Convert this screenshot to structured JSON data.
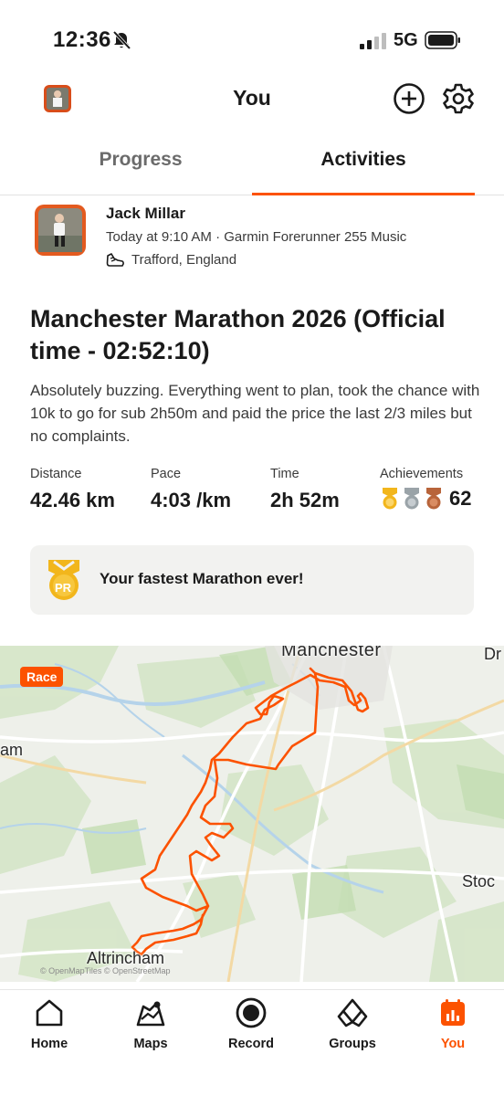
{
  "status_bar": {
    "time": "12:36",
    "network": "5G"
  },
  "header": {
    "title": "You",
    "icons": [
      "profile-avatar",
      "add-circle-icon",
      "gear-icon"
    ]
  },
  "tabs": [
    {
      "label": "Progress",
      "active": false
    },
    {
      "label": "Activities",
      "active": true
    }
  ],
  "activity": {
    "athlete_name": "Jack Millar",
    "meta": "Today at 9:10 AM · Garmin Forerunner 255 Music",
    "location": "Trafford, England",
    "title": "Manchester Marathon 2026 (Official time - 02:52:10)",
    "description": "Absolutely buzzing. Everything went to plan, took the chance with 10k to go for sub 2h50m and paid the price the last 2/3 miles but no complaints.",
    "stats": {
      "distance_label": "Distance",
      "distance_value": "42.46 km",
      "pace_label": "Pace",
      "pace_value": "4:03 /km",
      "time_label": "Time",
      "time_value": "2h 52m",
      "achievements_label": "Achievements",
      "achievements_value": "62"
    },
    "pr_card": {
      "badge": "PR",
      "text": "Your fastest Marathon ever!"
    }
  },
  "map": {
    "race_badge": "Race",
    "labels": {
      "manchester": "Manchester",
      "altrincham": "Altrincham",
      "west_edge": "am",
      "east_top": "Dr",
      "east_mid": "Stoc"
    },
    "attribution": "© OpenMapTiles © OpenStreetMap",
    "route_color": "#fc5200"
  },
  "bottom_nav": [
    {
      "label": "Home",
      "icon": "home-icon"
    },
    {
      "label": "Maps",
      "icon": "map-icon"
    },
    {
      "label": "Record",
      "icon": "record-icon"
    },
    {
      "label": "Groups",
      "icon": "groups-icon"
    },
    {
      "label": "You",
      "icon": "you-icon",
      "active": true
    }
  ],
  "colors": {
    "accent": "#fc5200",
    "gold": "#f2b61c",
    "silver": "#9aa3a8",
    "bronze": "#b8643a"
  }
}
